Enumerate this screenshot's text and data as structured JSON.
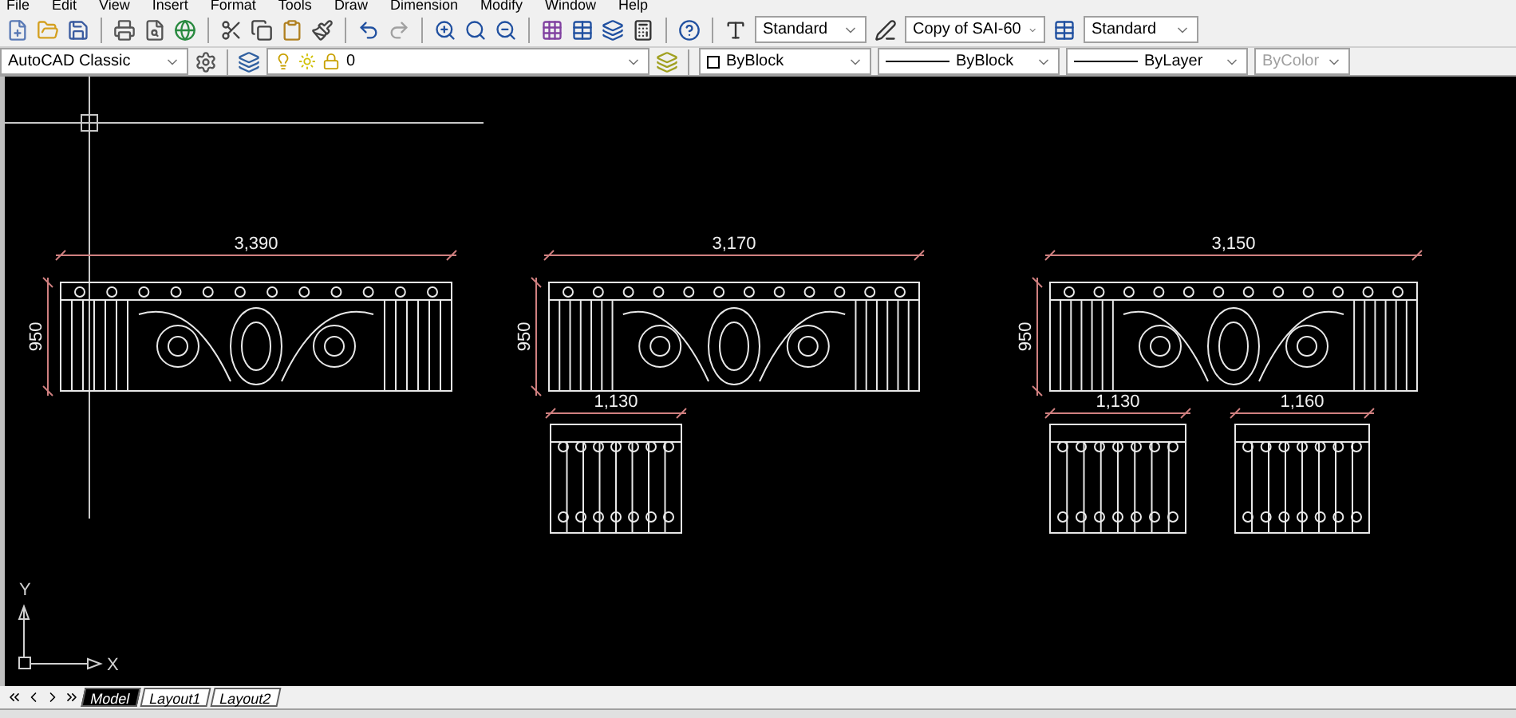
{
  "menu": [
    "File",
    "Edit",
    "View",
    "Insert",
    "Format",
    "Tools",
    "Draw",
    "Dimension",
    "Modify",
    "Window",
    "Help"
  ],
  "styles_toolbar": {
    "text_style": "Standard",
    "dim_style": "Copy of SAI-60",
    "table_style": "Standard"
  },
  "workspace": "AutoCAD Classic",
  "layer": "0",
  "properties_toolbar": [
    {
      "kind": "color",
      "value": "ByBlock",
      "disabled": false
    },
    {
      "kind": "line",
      "value": "ByBlock",
      "disabled": false
    },
    {
      "kind": "line",
      "value": "ByLayer",
      "disabled": false
    },
    {
      "kind": "plain",
      "value": "ByColor",
      "disabled": true
    }
  ],
  "drawings": [
    {
      "kind": "wide",
      "width_label": "3,390",
      "height_label": "950"
    },
    {
      "kind": "wide",
      "width_label": "3,170",
      "height_label": "950"
    },
    {
      "kind": "wide",
      "width_label": "3,150",
      "height_label": "950"
    },
    {
      "kind": "panel",
      "width_label": "1,130"
    },
    {
      "kind": "panel",
      "width_label": "1,130"
    },
    {
      "kind": "panel",
      "width_label": "1,160"
    }
  ],
  "ucs": {
    "x_label": "X",
    "y_label": "Y"
  },
  "tabs": [
    {
      "label": "Model",
      "selected": true
    },
    {
      "label": "Layout1",
      "selected": false
    },
    {
      "label": "Layout2",
      "selected": false
    }
  ]
}
